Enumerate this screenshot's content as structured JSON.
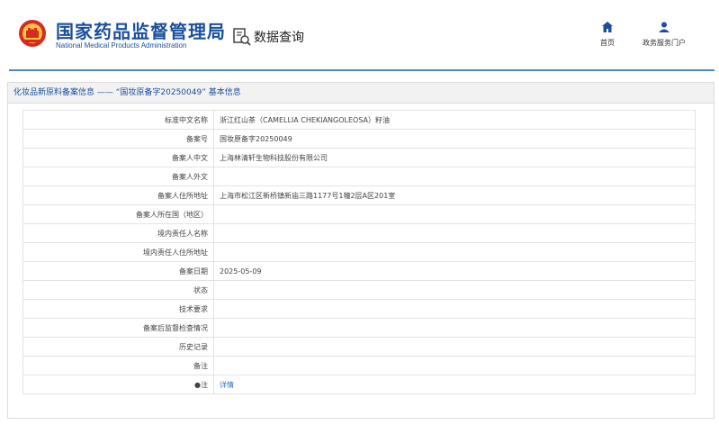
{
  "header": {
    "logo_cn": "国家药品监督管理局",
    "logo_en": "National Medical Products Administration",
    "data_query": "数据查询",
    "nav": {
      "home": "首页",
      "portal": "政务服务门户"
    }
  },
  "panel": {
    "title": "化妆品新原料备案信息 —— “国妆原备字20250049” 基本信息"
  },
  "rows": [
    {
      "label": "标准中文名称",
      "value": "浙江红山茶（CAMELLIA CHEKIANGOLEOSA）籽油"
    },
    {
      "label": "备案号",
      "value": "国妆原备字20250049"
    },
    {
      "label": "备案人中文",
      "value": "上海林清轩生物科技股份有限公司"
    },
    {
      "label": "备案人外文",
      "value": ""
    },
    {
      "label": "备案人住所地址",
      "value": "上海市松江区新桥镇新庙三路1177号1幢2层A区201室"
    },
    {
      "label": "备案人所在国（地区）",
      "value": ""
    },
    {
      "label": "境内责任人名称",
      "value": ""
    },
    {
      "label": "境内责任人住所地址",
      "value": ""
    },
    {
      "label": "备案日期",
      "value": "2025-05-09"
    },
    {
      "label": "状态",
      "value": ""
    },
    {
      "label": "技术要求",
      "value": ""
    },
    {
      "label": "备案后监督检查情况",
      "value": ""
    },
    {
      "label": "历史记录",
      "value": ""
    },
    {
      "label": "备注",
      "value": ""
    },
    {
      "label": "●注",
      "value": "详情"
    }
  ],
  "colors": {
    "brand": "#1a4f9c",
    "accent_line": "#4a86c8",
    "link": "#2b6fc2"
  }
}
